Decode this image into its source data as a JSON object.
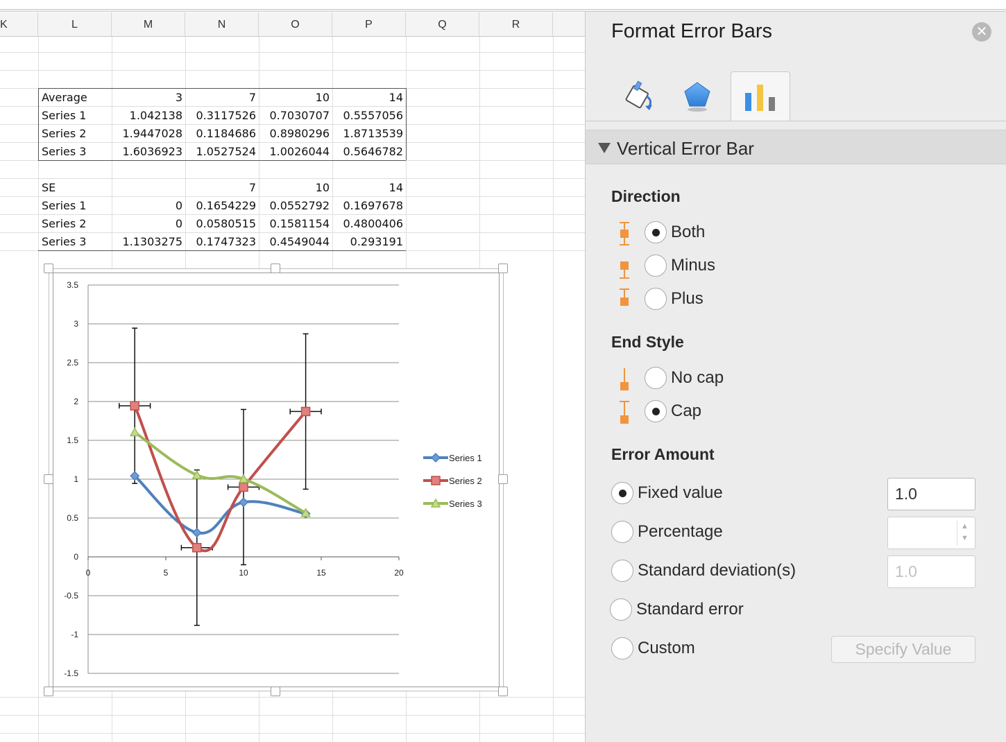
{
  "sheet": {
    "columns": [
      "K",
      "L",
      "M",
      "N",
      "O",
      "P",
      "Q",
      "R"
    ],
    "average_block": {
      "header": [
        "Average",
        "3",
        "7",
        "10",
        "14"
      ],
      "rows": [
        [
          "Series 1",
          "1.042138",
          "0.3117526",
          "0.7030707",
          "0.5557056"
        ],
        [
          "Series 2",
          "1.9447028",
          "0.1184686",
          "0.8980296",
          "1.8713539"
        ],
        [
          "Series 3",
          "1.6036923",
          "1.0527524",
          "1.0026044",
          "0.5646782"
        ]
      ]
    },
    "se_block": {
      "header": [
        "SE",
        "",
        "7",
        "10",
        "14"
      ],
      "rows": [
        [
          "Series 1",
          "0",
          "0.1654229",
          "0.0552792",
          "0.1697678"
        ],
        [
          "Series 2",
          "0",
          "0.0580515",
          "0.1581154",
          "0.4800406"
        ],
        [
          "Series 3",
          "1.1303275",
          "0.1747323",
          "0.4549044",
          "0.293191"
        ]
      ]
    }
  },
  "chart_data": {
    "type": "scatter",
    "smoothed_lines": true,
    "title": "",
    "xlabel": "",
    "ylabel": "",
    "xlim": [
      0,
      20
    ],
    "ylim": [
      -1.5,
      3.5
    ],
    "x_ticks": [
      "0",
      "5",
      "10",
      "15",
      "20"
    ],
    "y_ticks": [
      "3.5",
      "3",
      "2.5",
      "2",
      "1.5",
      "1",
      "0.5",
      "0",
      "-0.5",
      "-1",
      "-1.5"
    ],
    "grid": true,
    "legend_position": "right",
    "x": [
      3,
      7,
      10,
      14
    ],
    "series": [
      {
        "name": "Series 1",
        "color": "#4f81bd",
        "marker": "diamond",
        "values": [
          1.042138,
          0.3117526,
          0.7030707,
          0.5557056
        ]
      },
      {
        "name": "Series 2",
        "color": "#c0504d",
        "marker": "square",
        "values": [
          1.9447028,
          0.1184686,
          0.8980296,
          1.8713539
        ]
      },
      {
        "name": "Series 3",
        "color": "#9bbb59",
        "marker": "triangle",
        "values": [
          1.6036923,
          1.0527524,
          1.0026044,
          0.5646782
        ]
      }
    ],
    "error_bars": {
      "series": "Series 2",
      "vertical": {
        "direction": "Both",
        "end_style": "Cap",
        "fixed_value": 1.0
      },
      "horizontal": {
        "direction": "Both",
        "end_style": "Cap",
        "fixed_value": 1.0
      }
    }
  },
  "panel": {
    "title": "Format Error Bars",
    "close_icon": "close-icon",
    "tabs": [
      {
        "icon": "fill-bucket-icon"
      },
      {
        "icon": "pentagon-icon"
      },
      {
        "icon": "bar-chart-icon",
        "active": true
      }
    ],
    "section_label": "Vertical Error Bar",
    "direction": {
      "label": "Direction",
      "options": [
        {
          "label": "Both",
          "checked": true
        },
        {
          "label": "Minus",
          "checked": false
        },
        {
          "label": "Plus",
          "checked": false
        }
      ]
    },
    "end_style": {
      "label": "End Style",
      "options": [
        {
          "label": "No cap",
          "checked": false
        },
        {
          "label": "Cap",
          "checked": true
        }
      ]
    },
    "error_amount": {
      "label": "Error Amount",
      "options": [
        {
          "label": "Fixed value",
          "checked": true
        },
        {
          "label": "Percentage",
          "checked": false
        },
        {
          "label": "Standard deviation(s)",
          "checked": false
        },
        {
          "label": "Standard error",
          "checked": false
        },
        {
          "label": "Custom",
          "checked": false
        }
      ],
      "fixed_value": "1.0",
      "percentage_value": "",
      "stdev_value": "1.0",
      "specify_button": "Specify Value"
    },
    "accent_color": "#f0953e"
  }
}
